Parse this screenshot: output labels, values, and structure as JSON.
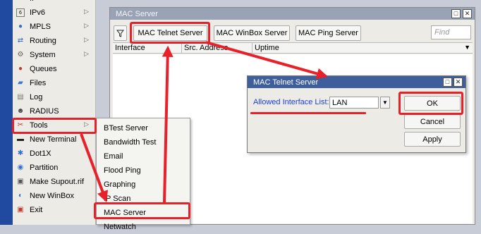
{
  "menu": {
    "items": [
      {
        "label": "IP",
        "icon": "ip-icon",
        "arrow": true
      },
      {
        "label": "IPv6",
        "icon": "ipv6-icon",
        "arrow": true
      },
      {
        "label": "MPLS",
        "icon": "mpls-icon",
        "arrow": true
      },
      {
        "label": "Routing",
        "icon": "routing-icon",
        "arrow": true
      },
      {
        "label": "System",
        "icon": "system-gear-icon",
        "arrow": true
      },
      {
        "label": "Queues",
        "icon": "queues-icon",
        "arrow": false
      },
      {
        "label": "Files",
        "icon": "folder-icon",
        "arrow": false
      },
      {
        "label": "Log",
        "icon": "log-icon",
        "arrow": false
      },
      {
        "label": "RADIUS",
        "icon": "radius-icon",
        "arrow": false
      },
      {
        "label": "Tools",
        "icon": "tools-icon",
        "arrow": true
      },
      {
        "label": "New Terminal",
        "icon": "terminal-icon",
        "arrow": false
      },
      {
        "label": "Dot1X",
        "icon": "dot1x-icon",
        "arrow": false
      },
      {
        "label": "Partition",
        "icon": "partition-icon",
        "arrow": false
      },
      {
        "label": "Make Supout.rif",
        "icon": "supout-icon",
        "arrow": false
      },
      {
        "label": "New WinBox",
        "icon": "winbox-icon",
        "arrow": false
      },
      {
        "label": "Exit",
        "icon": "exit-icon",
        "arrow": false
      }
    ]
  },
  "tools_submenu": {
    "items": [
      "BTest Server",
      "Bandwidth Test",
      "Email",
      "Flood Ping",
      "Graphing",
      "IP Scan",
      "MAC Server",
      "Netwatch"
    ]
  },
  "mac_server_window": {
    "title": "MAC Server",
    "filter_icon": "filter-icon",
    "buttons": {
      "telnet": "MAC Telnet Server",
      "winbox": "MAC WinBox Server",
      "ping": "MAC Ping Server"
    },
    "find_placeholder": "Find",
    "columns": [
      "Interface",
      "Src. Address",
      "Uptime"
    ],
    "restore_glyph": "□",
    "close_glyph": "✕"
  },
  "telnet_dialog": {
    "title": "MAC Telnet Server",
    "field_label": "Allowed Interface List:",
    "field_value": "LAN",
    "buttons": {
      "ok": "OK",
      "cancel": "Cancel",
      "apply": "Apply"
    }
  },
  "colors": {
    "annotation": "#e8202a",
    "dialog_title": "#3e5f9c",
    "window_title": "#9aa3b6",
    "label_blue": "#1b3fd6"
  }
}
